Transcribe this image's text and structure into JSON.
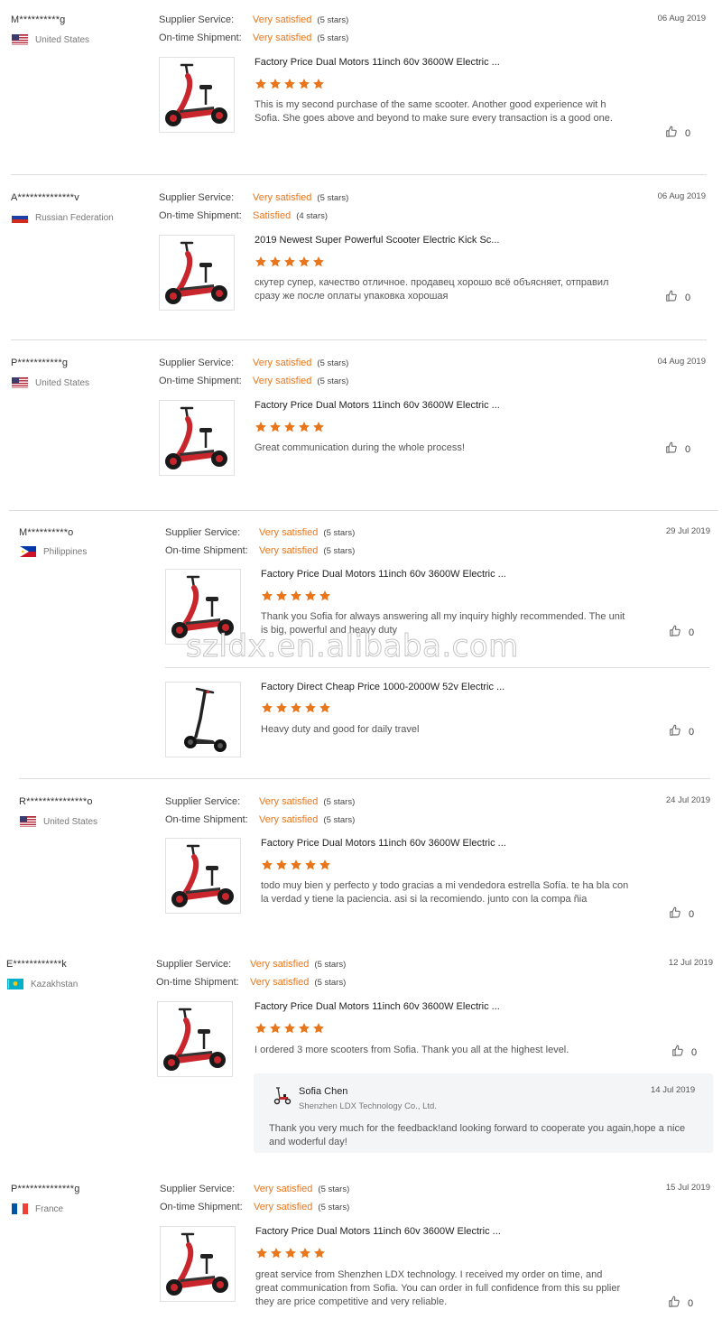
{
  "labels": {
    "supplier_service": "Supplier Service:",
    "ontime_shipment": "On-time Shipment:"
  },
  "colors": {
    "accent": "#e8761c",
    "divider": "#dcdcdc",
    "reply_bg": "#f4f5f7"
  },
  "watermark": "szldx.en.alibaba.com",
  "reviews": [
    {
      "buyer": "M**********g",
      "country": "United States",
      "flag": "us",
      "date": "06 Aug 2019",
      "supplier_service": "Very satisfied",
      "supplier_stars": "(5 stars)",
      "shipment": "Very satisfied",
      "shipment_stars": "(5 stars)",
      "items": [
        {
          "product": "Factory Price Dual Motors 11inch 60v 3600W Electric ...",
          "rating": 5,
          "text": "This is my second purchase of the same scooter.  Another good experience wit h Sofia.  She goes above and beyond to make sure every transaction is a good one.",
          "likes": "0"
        }
      ]
    },
    {
      "buyer": "A**************v",
      "country": "Russian Federation",
      "flag": "ru",
      "date": "06 Aug 2019",
      "supplier_service": "Very satisfied",
      "supplier_stars": "(5 stars)",
      "shipment": "Satisfied",
      "shipment_stars": "(4 stars)",
      "items": [
        {
          "product": "2019 Newest Super Powerful Scooter Electric Kick Sc...",
          "rating": 5,
          "text": "скутер супер, качество отличное. продавец хорошо всё объясняет, отправил сразу же после оплаты упаковка хорошая",
          "likes": "0"
        }
      ]
    },
    {
      "buyer": "P***********g",
      "country": "United States",
      "flag": "us",
      "date": "04 Aug 2019",
      "supplier_service": "Very satisfied",
      "supplier_stars": "(5 stars)",
      "shipment": "Very satisfied",
      "shipment_stars": "(5 stars)",
      "items": [
        {
          "product": "Factory Price Dual Motors 11inch 60v 3600W Electric ...",
          "rating": 5,
          "text": "Great communication during the whole process!",
          "likes": "0"
        }
      ]
    },
    {
      "buyer": "M**********o",
      "country": "Philippines",
      "flag": "ph",
      "date": "29 Jul 2019",
      "supplier_service": "Very satisfied",
      "supplier_stars": "(5 stars)",
      "shipment": "Very satisfied",
      "shipment_stars": "(5 stars)",
      "items": [
        {
          "product": "Factory Price Dual Motors 11inch 60v 3600W Electric ...",
          "rating": 5,
          "text": "Thank you Sofia for always answering all my inquiry highly recommended. The unit is big, powerful and heavy duty",
          "likes": "0"
        },
        {
          "product": "Factory Direct Cheap Price 1000-2000W 52v Electric ...",
          "rating": 5,
          "text": "Heavy duty and good for daily travel",
          "likes": "0"
        }
      ]
    },
    {
      "buyer": "R***************o",
      "country": "United States",
      "flag": "us",
      "date": "24 Jul 2019",
      "supplier_service": "Very satisfied",
      "supplier_stars": "(5 stars)",
      "shipment": "Very satisfied",
      "shipment_stars": "(5 stars)",
      "items": [
        {
          "product": "Factory Price Dual Motors 11inch 60v 3600W Electric ...",
          "rating": 5,
          "text": "todo  muy bien  y perfecto  y todo gracias  a mi vendedora estrella Sofía.  te ha bla con la verdad y tiene la paciencia. asi si la recomiendo. junto con la compa ñia",
          "likes": "0"
        }
      ]
    },
    {
      "buyer": "E************k",
      "country": "Kazakhstan",
      "flag": "kz",
      "date": "12 Jul 2019",
      "supplier_service": "Very satisfied",
      "supplier_stars": "(5 stars)",
      "shipment": "Very satisfied",
      "shipment_stars": "(5 stars)",
      "items": [
        {
          "product": "Factory Price Dual Motors 11inch 60v 3600W Electric ...",
          "rating": 5,
          "text": "I ordered 3 more scooters from Sofia.  Thank you all at the highest level.",
          "likes": "0"
        }
      ],
      "reply": {
        "name": "Sofia Chen",
        "company": "Shenzhen LDX Technology Co., Ltd.",
        "date": "14 Jul 2019",
        "text": "Thank you very much for the feedback!and looking forward to cooperate you again,hope a nice and woderful day!"
      }
    },
    {
      "buyer": "P**************g",
      "country": "France",
      "flag": "fr",
      "date": "15 Jul 2019",
      "supplier_service": "Very satisfied",
      "supplier_stars": "(5 stars)",
      "shipment": "Very satisfied",
      "shipment_stars": "(5 stars)",
      "items": [
        {
          "product": "Factory Price Dual Motors 11inch 60v 3600W Electric ...",
          "rating": 5,
          "text": "great service from Shenzhen LDX technology. I received my order on time, and great communication from Sofia. You can order in full confidence from this su pplier they are price competitive and very reliable.",
          "likes": "0"
        }
      ]
    }
  ]
}
